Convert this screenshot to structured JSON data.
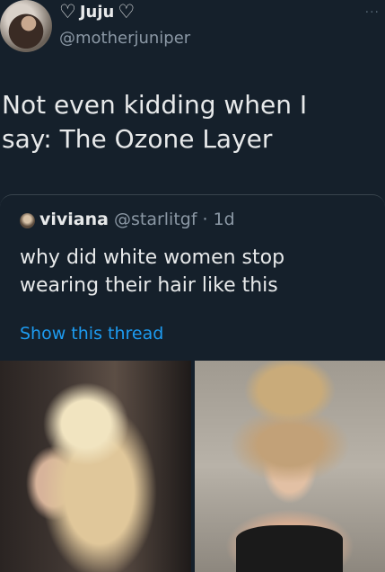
{
  "tweet": {
    "heart_left": "♡",
    "display_name": "Juju",
    "heart_right": "♡",
    "handle": "@motherjuniper",
    "more": "···",
    "text": "Not even kidding when I\nsay: The Ozone Layer"
  },
  "quote": {
    "display_name": "viviana",
    "handle": "@starlitgf",
    "separator": "·",
    "time": "1d",
    "text": "why did white women stop\nwearing their hair like this",
    "show_thread": "Show this thread"
  },
  "colors": {
    "background": "#15202b",
    "text": "#e7e9ea",
    "secondary": "#8b98a5",
    "link": "#1d9bf0",
    "border": "#38444d"
  }
}
